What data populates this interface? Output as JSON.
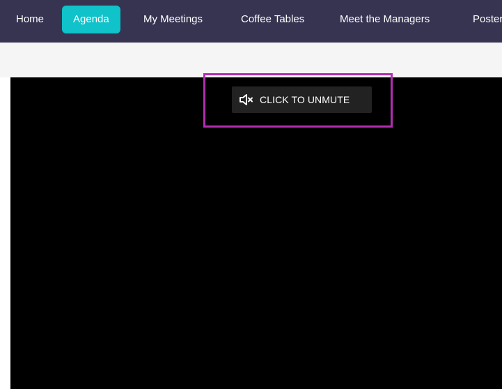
{
  "nav": {
    "items": [
      {
        "label": "Home",
        "active": false
      },
      {
        "label": "Agenda",
        "active": true
      },
      {
        "label": "My Meetings",
        "active": false
      },
      {
        "label": "Coffee Tables",
        "active": false
      },
      {
        "label": "Meet the Managers",
        "active": false
      },
      {
        "label": "Posters",
        "active": false
      }
    ]
  },
  "player": {
    "unmute_label": "CLICK TO UNMUTE",
    "unmute_icon": "speaker-muted-icon"
  },
  "colors": {
    "navbar_bg": "#363451",
    "active_tab_bg": "#10c2c9",
    "highlight_border": "#b42db2",
    "video_bg": "#000000"
  }
}
